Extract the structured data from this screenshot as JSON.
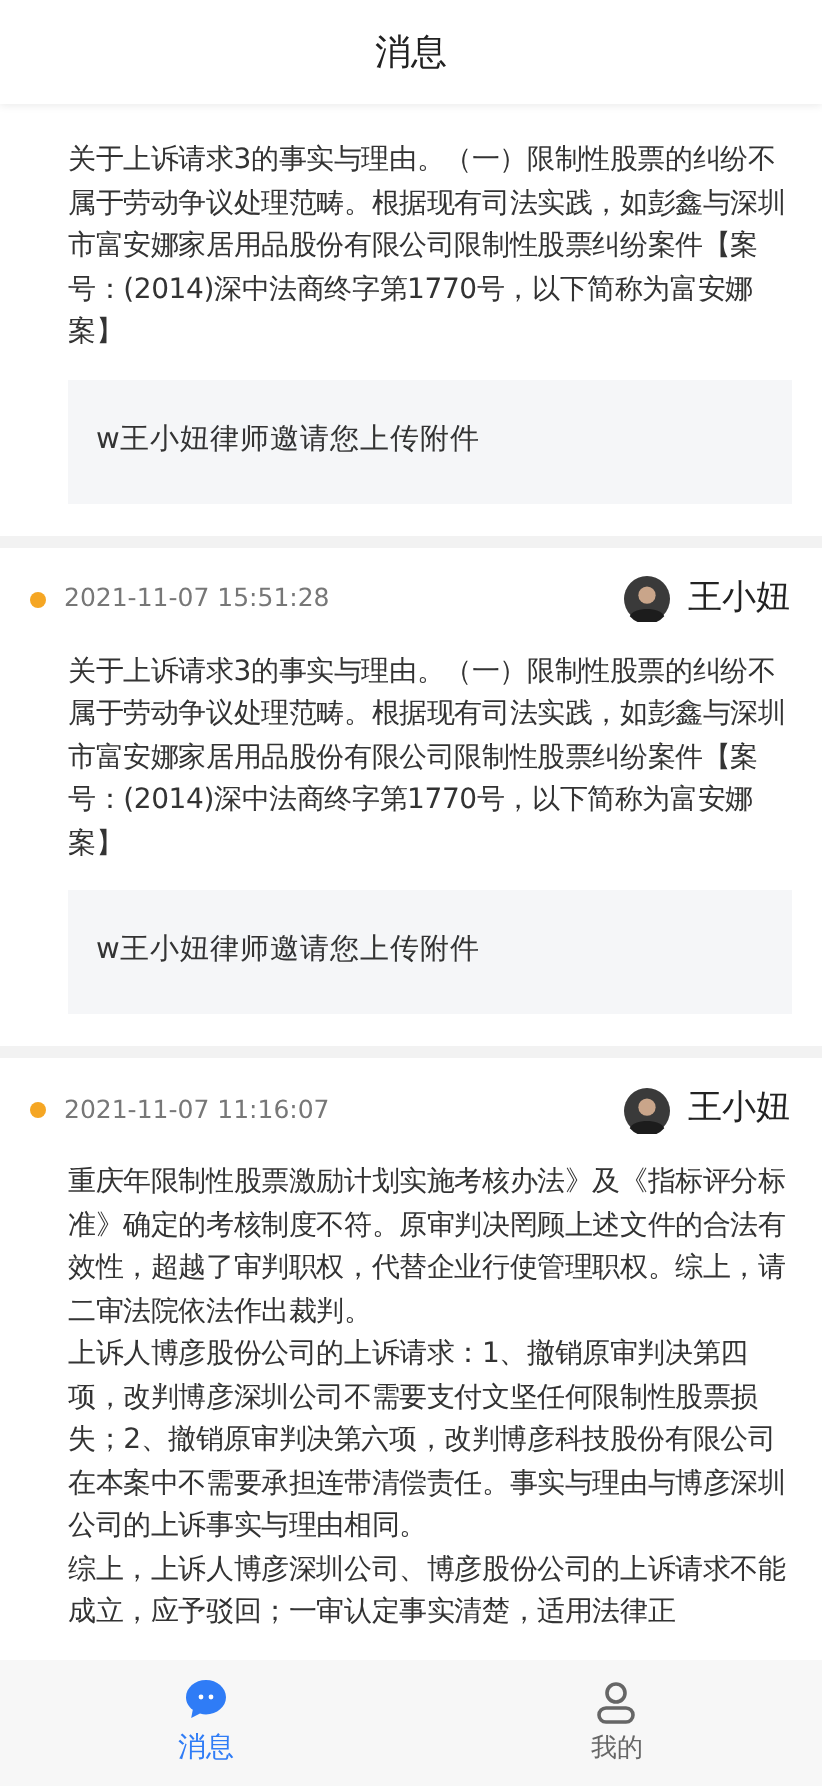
{
  "header": {
    "title": "消息"
  },
  "messages": [
    {
      "body": [
        "关于上诉请求3的事实与理由。（一）限制性股票的纠纷不属于劳动争议处理范畴。根据现有司法实践，如彭鑫与深圳市富安娜家居用品股份有限公司限制性股票纠纷案件【案号：(2014)深中法商终字第1770号，以下简称为富安娜案】"
      ],
      "attachment": "w王小妞律师邀请您上传附件"
    },
    {
      "unread": true,
      "time": "2021-11-07 15:51:28",
      "author": "王小妞",
      "body": [
        "关于上诉请求3的事实与理由。（一）限制性股票的纠纷不属于劳动争议处理范畴。根据现有司法实践，如彭鑫与深圳市富安娜家居用品股份有限公司限制性股票纠纷案件【案号：(2014)深中法商终字第1770号，以下简称为富安娜案】"
      ],
      "attachment": "w王小妞律师邀请您上传附件"
    },
    {
      "unread": true,
      "time": "2021-11-07 11:16:07",
      "author": "王小妞",
      "body": [
        "重庆年限制性股票激励计划实施考核办法》及《指标评分标准》确定的考核制度不符。原审判决罔顾上述文件的合法有效性，超越了审判职权，代替企业行使管理职权。综上，请二审法院依法作出裁判。",
        "上诉人博彦股份公司的上诉请求：1、撤销原审判决第四项，改判博彦深圳公司不需要支付文坚任何限制性股票损失；2、撤销原审判决第六项，改判博彦科技股份有限公司在本案中不需要承担连带清偿责任。事实与理由与博彦深圳公司的上诉事实与理由相同。",
        "综上，上诉人博彦深圳公司、博彦股份公司的上诉请求不能成立，应予驳回；一审认定事实清楚，适用法律正"
      ]
    }
  ],
  "tabbar": [
    {
      "label": "消息",
      "kind": "chat",
      "selected": true
    },
    {
      "label": "我的",
      "kind": "profile",
      "selected": false
    }
  ]
}
